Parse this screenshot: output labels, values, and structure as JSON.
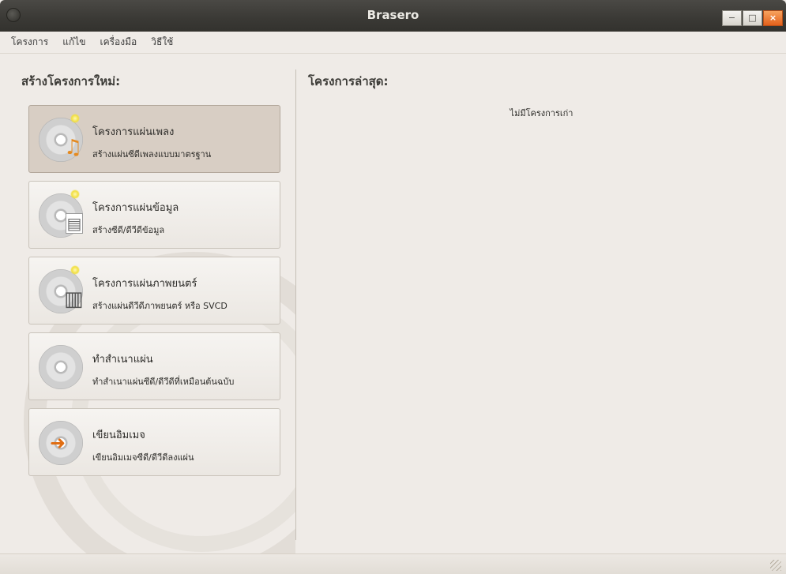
{
  "window": {
    "title": "Brasero"
  },
  "menu": [
    "โครงการ",
    "แก้ไข",
    "เครื่องมือ",
    "วิธีใช้"
  ],
  "left": {
    "heading": "สร้างโครงการใหม่:",
    "projects": [
      {
        "title": "โครงการแผ่นเพลง",
        "desc": "สร้างแผ่นซีดีเพลงแบบมาตรฐาน",
        "icon": "audio-disc-icon",
        "overlay": "♫"
      },
      {
        "title": "โครงการแผ่นข้อมูล",
        "desc": "สร้างซีดี/ดีวีดีข้อมูล",
        "icon": "data-disc-icon",
        "overlay": "▤"
      },
      {
        "title": "โครงการแผ่นภาพยนตร์",
        "desc": "สร้างแผ่นดีวีดีภาพยนตร์ หรือ SVCD",
        "icon": "video-disc-icon",
        "overlay": "▥"
      },
      {
        "title": "ทำสำเนาแผ่น",
        "desc": "ทำสำเนาแผ่นซีดี/ดีวีดีที่เหมือนต้นฉบับ",
        "icon": "copy-disc-icon",
        "overlay": ""
      },
      {
        "title": "เขียนอิมเมจ",
        "desc": "เขียนอิมเมจซีดี/ดีวีดีลงแผ่น",
        "icon": "burn-image-icon",
        "overlay": "➜"
      }
    ]
  },
  "right": {
    "heading": "โครงการล่าสุด:",
    "empty": "ไม่มีโครงการเก่า"
  },
  "colors": {
    "accent_close": "#e3611c",
    "selected_bg": "#d8cec4"
  }
}
